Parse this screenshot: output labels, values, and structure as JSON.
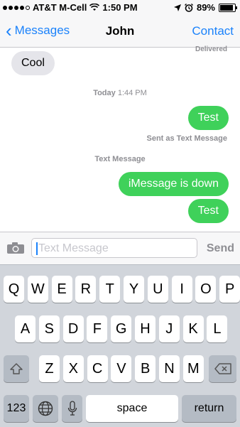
{
  "status_bar": {
    "carrier": "AT&T M-Cell",
    "time": "1:50 PM",
    "battery": "89%",
    "battery_level": 0.89,
    "signal_bars": 4,
    "icons": [
      "wifi-icon",
      "location-arrow-icon",
      "alarm-clock-icon",
      "battery-icon"
    ]
  },
  "nav": {
    "back_label": "Messages",
    "title": "John",
    "contact_label": "Contact",
    "accent_color": "#1a82fb"
  },
  "thread": {
    "delivered_label": "Delivered",
    "cool_message": "Cool",
    "timestamp_day": "Today",
    "timestamp_time": "1:44 PM",
    "test_message_1": "Test",
    "sent_as_text": "Sent as Text Message",
    "text_message_label": "Text Message",
    "imessage_down": "iMessage is down",
    "test_message_2": "Test",
    "outgoing_color": "#3fd15a",
    "incoming_color": "#e5e5ea"
  },
  "input": {
    "placeholder": "Text Message",
    "send_label": "Send"
  },
  "keyboard": {
    "row1": [
      "Q",
      "W",
      "E",
      "R",
      "T",
      "Y",
      "U",
      "I",
      "O",
      "P"
    ],
    "row2": [
      "A",
      "S",
      "D",
      "F",
      "G",
      "H",
      "J",
      "K",
      "L"
    ],
    "row3": [
      "Z",
      "X",
      "C",
      "V",
      "B",
      "N",
      "M"
    ],
    "numbers_label": "123",
    "space_label": "space",
    "return_label": "return"
  }
}
